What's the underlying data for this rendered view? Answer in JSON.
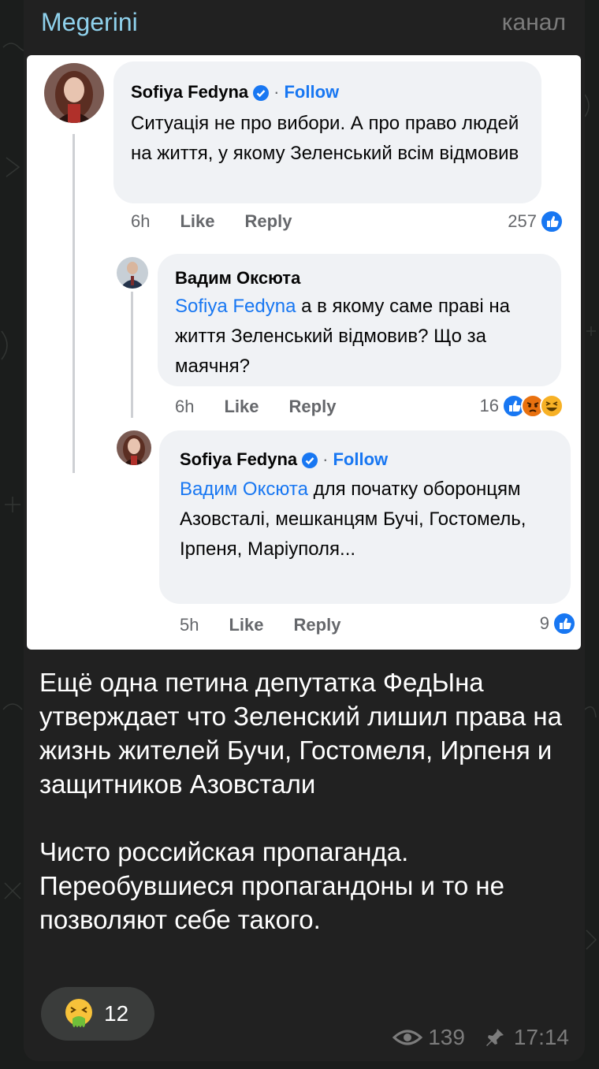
{
  "channel": {
    "name": "Megerini",
    "type_label": "канал"
  },
  "embedded_screenshot": {
    "comments": [
      {
        "author": "Sofiya Fedyna",
        "verified": true,
        "follow_label": "Follow",
        "text": "Ситуація не про вибори. А про право людей на життя, у якому Зеленський всім відмовив",
        "time": "6h",
        "like_label": "Like",
        "reply_label": "Reply",
        "reaction_count": "257",
        "reactions": [
          "like"
        ]
      },
      {
        "author": "Вадим Оксюта",
        "verified": false,
        "mention": "Sofiya Fedyna",
        "text": " а в якому саме праві на життя Зеленський відмовив? Що за маячня?",
        "time": "6h",
        "like_label": "Like",
        "reply_label": "Reply",
        "reaction_count": "16",
        "reactions": [
          "like",
          "angry",
          "haha"
        ]
      },
      {
        "author": "Sofiya Fedyna",
        "verified": true,
        "follow_label": "Follow",
        "mention": "Вадим Оксюта",
        "text": " для початку оборонцям Азовсталі, мешканцям Бучі, Гостомель, Ірпеня, Маріуполя...",
        "time": "5h",
        "like_label": "Like",
        "reply_label": "Reply",
        "reaction_count": "9",
        "reactions": [
          "like"
        ]
      }
    ]
  },
  "post": {
    "text": "Ещё одна петина депутатка ФедЫна утверждает что Зеленский лишил права на жизнь жителей Бучи, Гостомеля, Ирпеня и защитников Азовстали\n\nЧисто российская пропаганда. Переобувшиеся пропагандоны и то не позволяют себе такого."
  },
  "reaction": {
    "emoji_icon": "vomiting-face-icon",
    "count": "12"
  },
  "footer": {
    "views": "139",
    "time": "17:14",
    "views_icon": "eye-icon",
    "pin_icon": "pin-icon"
  },
  "colors": {
    "channel_name": "#8fd1ec",
    "fb_blue": "#1877f2",
    "bubble": "#212121"
  }
}
